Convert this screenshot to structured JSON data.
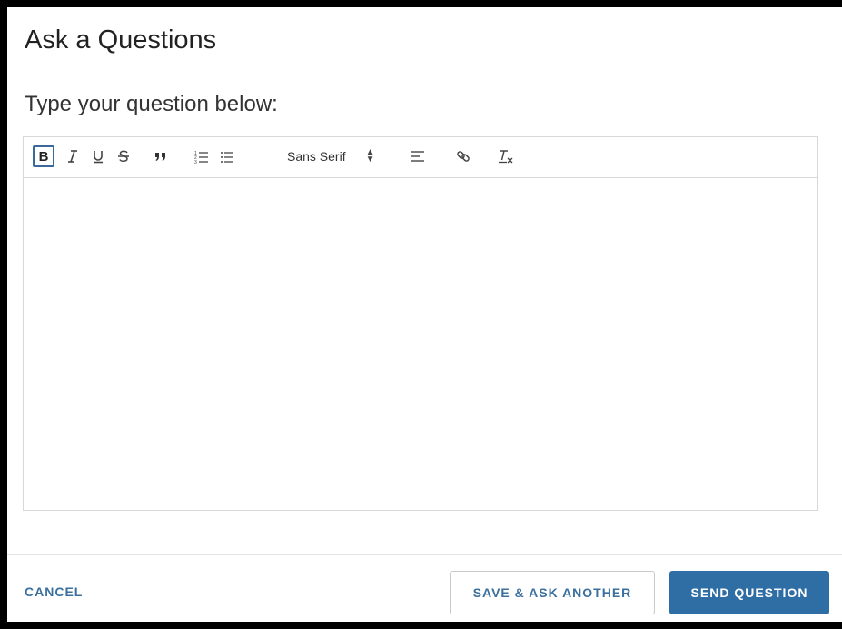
{
  "dialog": {
    "title": "Ask a Questions",
    "prompt": "Type your question below:"
  },
  "toolbar": {
    "bold_label": "B",
    "font_select_value": "Sans Serif",
    "icons": [
      "bold-icon",
      "italic-icon",
      "underline-icon",
      "strike-icon",
      "blockquote-icon",
      "ordered-list-icon",
      "bullet-list-icon",
      "align-icon",
      "link-icon",
      "clear-format-icon"
    ]
  },
  "editor": {
    "value": ""
  },
  "footer": {
    "cancel_label": "CANCEL",
    "save_label": "SAVE & ASK ANOTHER",
    "send_label": "SEND QUESTION"
  },
  "colors": {
    "accent": "#2f6ea5",
    "link": "#3a6f9e"
  }
}
